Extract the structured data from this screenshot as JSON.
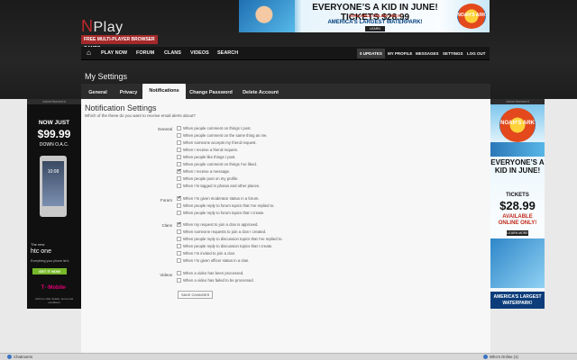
{
  "brand": {
    "logo_n": "N",
    "logo_rest": "Play",
    "tagline": "FREE MULTI-PLAYER BROWSER GAMES"
  },
  "top_ad": {
    "line1": "EVERYONE’S A KID IN JUNE! TICKETS $28.99",
    "line2": "AVAILABLE ONLINE ONLY!",
    "line3": "AMERICA’S LARGEST WATERPARK!",
    "learn": "LEARN MORE",
    "badge": "NOAH’S ARK"
  },
  "nav": {
    "items": [
      "PLAY NOW",
      "FORUM",
      "CLANS",
      "VIDEOS",
      "SEARCH"
    ],
    "updates": "0 UPDATES",
    "right": [
      "MY PROFILE",
      "MESSAGES",
      "SETTINGS",
      "LOG OUT"
    ]
  },
  "page": {
    "title": "My Settings"
  },
  "tabs": [
    "General",
    "Privacy",
    "Notifications",
    "Change Password",
    "Delete Account"
  ],
  "active_tab": "Notifications",
  "left_ad": {
    "label": "Advertisement",
    "now_just": "NOW JUST",
    "price": "$99.99",
    "down": "DOWN O.A.C.",
    "clock": "10:08",
    "new": "The new",
    "htc": "htc one",
    "tagline": "Everything your phone isn’t.",
    "get_now": "GET IT NOW",
    "tmobile": "T··Mobile·",
    "fine": "Click for offer details, terms and conditions"
  },
  "right_ad": {
    "label": "Advertisement",
    "noahs": "NOAH’S ARK",
    "r1": "EVERYONE’S A KID IN JUNE!",
    "r2": "TICKETS",
    "r3": "$28.99",
    "r4": "AVAILABLE",
    "r5": "ONLINE ONLY!",
    "learn": "LEARN MORE",
    "r6": "AMERICA’S LARGEST WATERPARK!"
  },
  "content": {
    "heading": "Notification Settings",
    "subheading": "Which of the these do you want to receive email alerts about?",
    "sections": [
      {
        "label": "General",
        "options": [
          {
            "text": "When people comment on things I post.",
            "checked": false
          },
          {
            "text": "When people comment on the same thing as me.",
            "checked": false
          },
          {
            "text": "When someone accepts my friend request.",
            "checked": false
          },
          {
            "text": "When I receive a friend request.",
            "checked": false
          },
          {
            "text": "When people like things I post.",
            "checked": false
          },
          {
            "text": "When people comment on things I’ve liked.",
            "checked": false
          },
          {
            "text": "When I receive a message.",
            "checked": true
          },
          {
            "text": "When people post on my profile.",
            "checked": false
          },
          {
            "text": "When I’m tagged in photos and other places.",
            "checked": false
          }
        ]
      },
      {
        "label": "Forum",
        "options": [
          {
            "text": "When I’m given moderator status in a forum.",
            "checked": true
          },
          {
            "text": "When people reply to forum topics that I’ve replied to.",
            "checked": false
          },
          {
            "text": "When people reply to forum topics that I create.",
            "checked": false
          }
        ]
      },
      {
        "label": "Clans",
        "options": [
          {
            "text": "When my request to join a clan is approved.",
            "checked": true
          },
          {
            "text": "When someone requests to join a clan I created.",
            "checked": false
          },
          {
            "text": "When people reply to discussion topics that I’ve replied to.",
            "checked": false
          },
          {
            "text": "When people reply to discussion topics that I create.",
            "checked": false
          },
          {
            "text": "When I’m invited to join a clan.",
            "checked": false
          },
          {
            "text": "When I’m given officer status in a clan.",
            "checked": false
          }
        ]
      },
      {
        "label": "Videos",
        "options": [
          {
            "text": "When a video has been processed.",
            "checked": false
          },
          {
            "text": "When a video has failed to be processed.",
            "checked": false
          }
        ]
      }
    ],
    "save_label": "SAVE CHANGES"
  },
  "bottom": {
    "chatrooms": "Chatrooms",
    "whos_online": "Who’s Online (1)"
  }
}
